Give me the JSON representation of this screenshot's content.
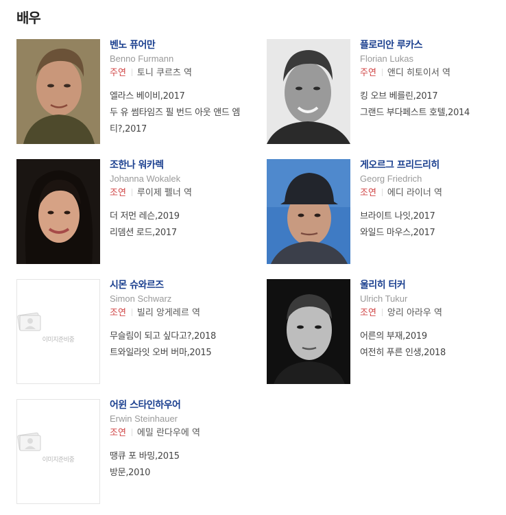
{
  "section": {
    "title": "배우"
  },
  "actors": [
    {
      "name_ko": "벤노 퓨어만",
      "name_en": "Benno Furmann",
      "role_type": "주연",
      "role": "토니 쿠르츠 역",
      "works": [
        "엘라스 베이비,2017",
        "두 유 썸타임즈 필 번드 아웃 앤드 엠티?,2017"
      ],
      "photo": "actor-photo"
    },
    {
      "name_ko": "플로리안 루카스",
      "name_en": "Florian Lukas",
      "role_type": "주연",
      "role": "앤디 히토이서 역",
      "works": [
        "킹 오브 베를린,2017",
        "그랜드 부다페스트 호텔,2014"
      ],
      "photo": "actor-photo"
    },
    {
      "name_ko": "조한나 워카렉",
      "name_en": "Johanna Wokalek",
      "role_type": "조연",
      "role": "루이제 펠너 역",
      "works": [
        "더 저먼 레슨,2019",
        "리뎀션 로드,2017"
      ],
      "photo": "actor-photo"
    },
    {
      "name_ko": "게오르그 프리드리히",
      "name_en": "Georg Friedrich",
      "role_type": "조연",
      "role": "에디 라이너 역",
      "works": [
        "브라이트 나잇,2017",
        "와일드 마우스,2017"
      ],
      "photo": "actor-photo"
    },
    {
      "name_ko": "시몬 슈와르즈",
      "name_en": "Simon Schwarz",
      "role_type": "조연",
      "role": "빌리 앙게레르 역",
      "works": [
        "무슬림이 되고 싶다고?,2018",
        "트와일라잇 오버 버마,2015"
      ],
      "photo": "placeholder",
      "placeholder_text": "이미지준비중"
    },
    {
      "name_ko": "울리히 터커",
      "name_en": "Ulrich Tukur",
      "role_type": "조연",
      "role": "앙리 아라우 역",
      "works": [
        "어른의 부재,2019",
        "여전히 푸른 인생,2018"
      ],
      "photo": "actor-photo"
    },
    {
      "name_ko": "어윈 스타인하우어",
      "name_en": "Erwin Steinhauer",
      "role_type": "조연",
      "role": "에밀 란다우에 역",
      "works": [
        "땡큐 포 바밍,2015",
        "방문,2010"
      ],
      "photo": "placeholder",
      "placeholder_text": "이미지준비중"
    }
  ],
  "colors": {
    "name": "#1a3f8f",
    "role_type": "#d04545",
    "english_name": "#999999"
  }
}
